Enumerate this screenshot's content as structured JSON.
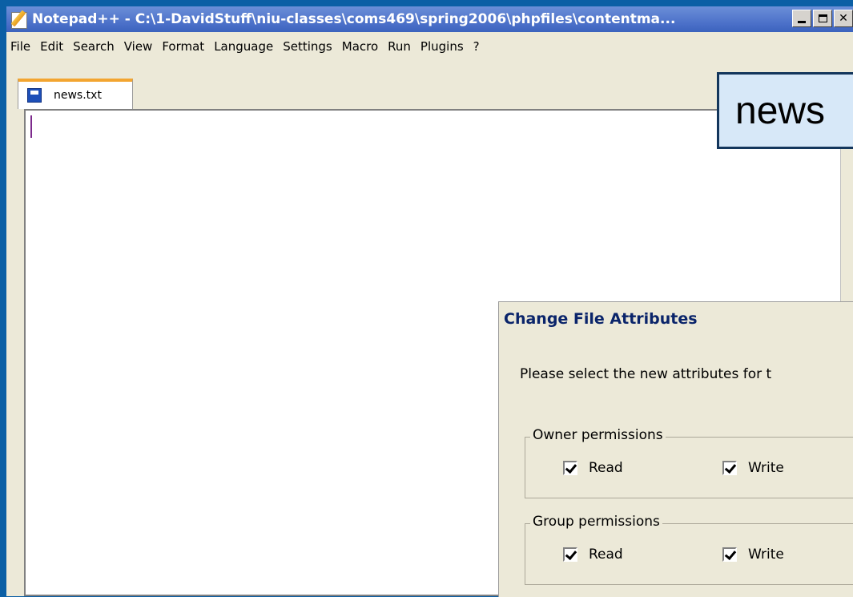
{
  "window": {
    "title": "Notepad++ - C:\\1-DavidStuff\\niu-classes\\coms469\\spring2006\\phpfiles\\contentma..."
  },
  "menu": [
    "File",
    "Edit",
    "Search",
    "View",
    "Format",
    "Language",
    "Settings",
    "Macro",
    "Run",
    "Plugins",
    "?"
  ],
  "tabs": [
    {
      "label": "news.txt",
      "active": true
    }
  ],
  "editor": {
    "content": ""
  },
  "callout": {
    "text": "news"
  },
  "dialog": {
    "title": "Change File Attributes",
    "prompt": "Please select the new attributes for t",
    "owner": {
      "legend": "Owner permissions",
      "read_label": "Read",
      "read_checked": true,
      "write_label": "Write",
      "write_checked": true
    },
    "group": {
      "legend": "Group permissions",
      "read_label": "Read",
      "read_checked": true,
      "write_label": "Write",
      "write_checked": true
    }
  },
  "colors": {
    "desktop": "#0b5fa5",
    "titlebar": "#4a6fc8",
    "tab_accent": "#f3a530",
    "dialog_title": "#0a246a",
    "callout_bg": "#d7e8f8"
  }
}
